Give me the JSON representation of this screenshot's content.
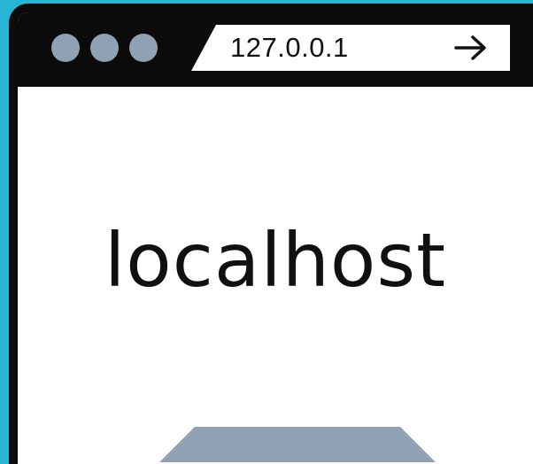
{
  "colors": {
    "background": "#27b5d6",
    "frame": "#0b0b0b",
    "page": "#ffffff",
    "window_dots": "#8fa2b3",
    "bottom_shape": "#8fa2b3"
  },
  "window_controls": {
    "dots": [
      "window-dot",
      "window-dot",
      "window-dot"
    ]
  },
  "address_bar": {
    "value": "127.0.0.1",
    "go_icon": "arrow-right-icon"
  },
  "page": {
    "heading": "localhost"
  }
}
